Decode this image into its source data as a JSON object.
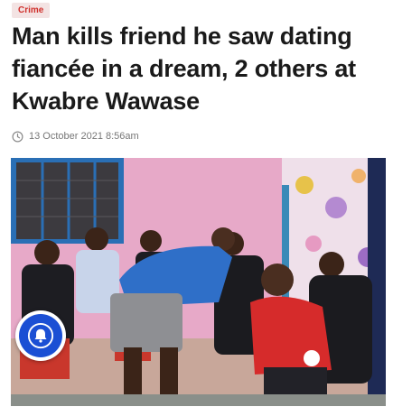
{
  "article": {
    "category": "Crime",
    "title": "Man kills friend he saw dating fiancée in a dream, 2 others at Kwabre Wawase",
    "date": "13 October 2021 8:56am"
  },
  "icons": {
    "timestamp": "clock-icon",
    "notification": "bell-icon"
  },
  "colors": {
    "category_text": "#d0312d",
    "category_bg": "#f3e3e3",
    "notification_blue": "#1b4fd4"
  }
}
